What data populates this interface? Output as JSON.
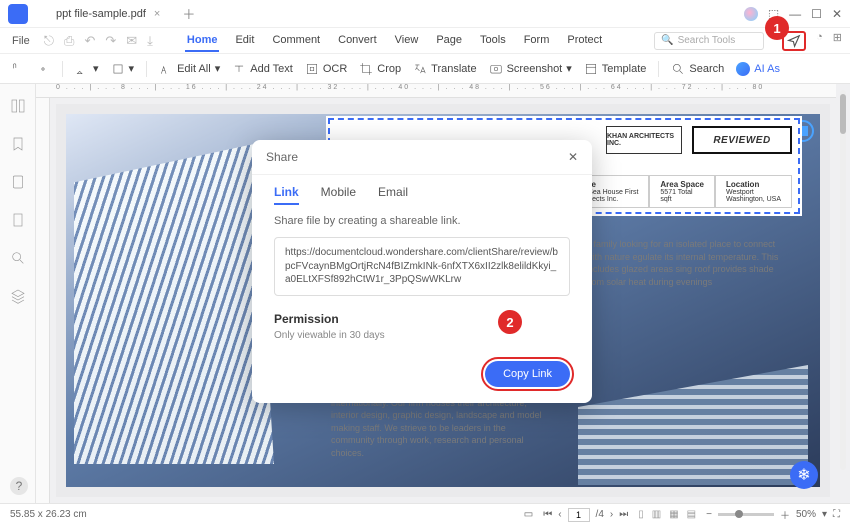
{
  "titlebar": {
    "tab_name": "ppt file-sample.pdf"
  },
  "menubar": {
    "file": "File",
    "menus": [
      "Home",
      "Edit",
      "Comment",
      "Convert",
      "View",
      "Page",
      "Tools",
      "Form",
      "Protect"
    ],
    "active_index": 0,
    "search_placeholder": "Search Tools"
  },
  "ribbon": {
    "edit_all": "Edit All",
    "add_text": "Add Text",
    "ocr": "OCR",
    "crop": "Crop",
    "translate": "Translate",
    "screenshot": "Screenshot",
    "template": "Template",
    "search": "Search",
    "ai": "AI As"
  },
  "ruler_h": "0 . . . | . . . 8 . . . | . . . 16 . . . | . . . 24 . . . | . . . 32 . . . | . . . 40 . . . | . . . 48 . . . | . . . 56 . . . | . . . 64 . . . | . . . 72 . . . | . . . 80",
  "doc": {
    "brand1": "KHAN ARCHITECTS INC.",
    "brand2": "REVIEWED",
    "cells": [
      {
        "h": "Name",
        "v1": "The Sea House First",
        "v2": "Architects Inc."
      },
      {
        "h": "Area Space",
        "v1": "5571 Total",
        "v2": "sqft"
      },
      {
        "h": "Location",
        "v1": "Westport",
        "v2": "Washington, USA"
      }
    ],
    "para1": "a family looking for an isolated place to connect with nature\n\negulate its internal temperature. This includes glazed areas\nsing roof provides shade from solar heat during evenings",
    "para2": "buildings and airport complexes, locally and internationally. Our firm houses their architecture, interior design, graphic design, landscape and model making staff. We strieve to be leaders in the community through work, research and personal choices."
  },
  "dialog": {
    "title": "Share",
    "tabs": [
      "Link",
      "Mobile",
      "Email"
    ],
    "active_tab": 0,
    "desc": "Share file by creating a shareable link.",
    "link": "https://documentcloud.wondershare.com/clientShare/review/bpcFVcaynBMgOrtjRcN4fBIZmkINk-6nfXTX6xII2zlk8elildKkyi_a0ELtXFSf892hCtW1r_3PpQSwWKLrw",
    "perm_heading": "Permission",
    "perm_sub": "Only viewable in 30 days",
    "copy_label": "Copy Link"
  },
  "callouts": {
    "one": "1",
    "two": "2"
  },
  "status": {
    "coords": "55.85 x 26.23 cm",
    "page_cur": "1",
    "page_total": "/4",
    "zoom": "50%"
  },
  "colors": {
    "accent": "#3b6cf6",
    "danger": "#e02a2a"
  }
}
